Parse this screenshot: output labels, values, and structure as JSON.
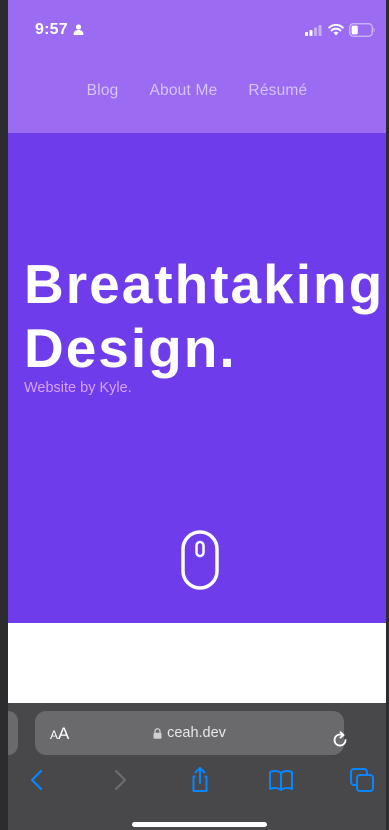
{
  "status_bar": {
    "time": "9:57",
    "icons": [
      "person-icon",
      "signal-icon",
      "wifi-icon",
      "battery-icon"
    ]
  },
  "nav": {
    "links": [
      {
        "label": "Blog"
      },
      {
        "label": "About Me"
      },
      {
        "label": "Résumé"
      }
    ]
  },
  "hero": {
    "title_line1": "Breathtaking",
    "title_line2": "Design.",
    "subtitle": "Website by Kyle.",
    "scroll_indicator_icon": "mouse-icon"
  },
  "colors": {
    "top_band": "#9b6bf1",
    "hero_bg": "#6e3ceb",
    "nav_link": "#d8c4ff",
    "subtitle": "#d8a3f5",
    "toolbar_bg": "#48484a",
    "toolbar_icon_active": "#0a84ff",
    "toolbar_icon_disabled": "#6c6c70"
  },
  "browser": {
    "aa_small": "A",
    "aa_large": "A",
    "url": "ceah.dev",
    "toolbar_icons": [
      "back-icon",
      "forward-icon",
      "share-icon",
      "bookmarks-icon",
      "tabs-icon"
    ]
  }
}
